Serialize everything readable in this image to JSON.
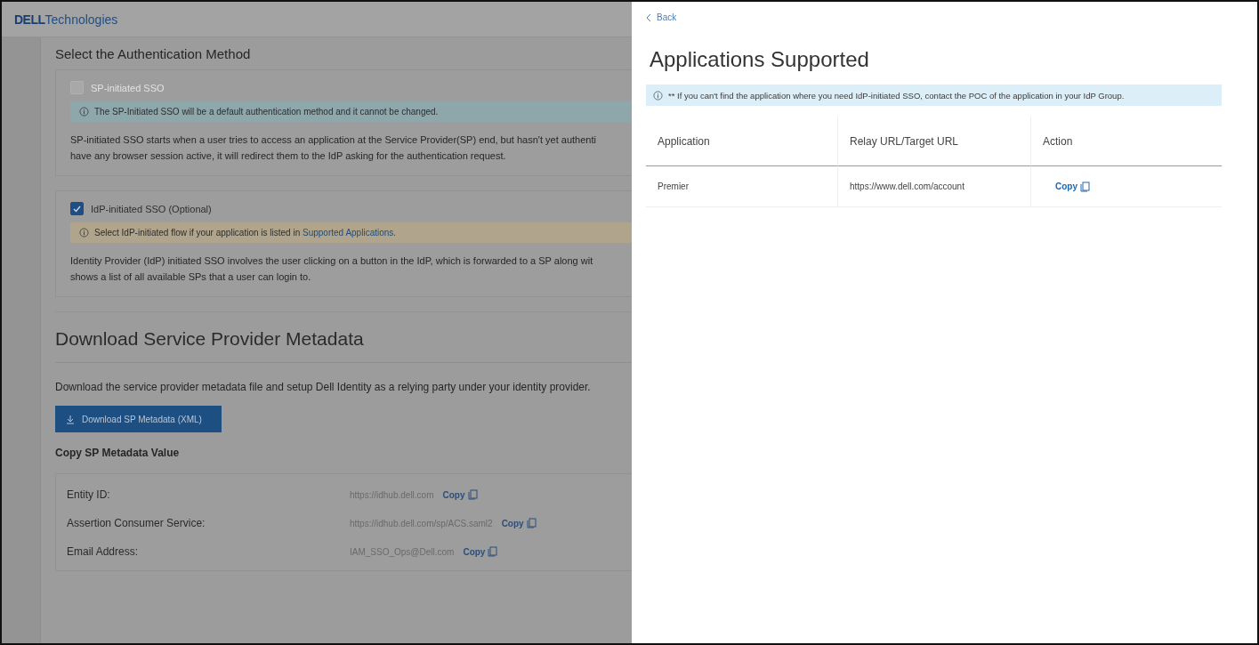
{
  "header": {
    "logo_mark": "DELL",
    "logo_text": "Technologies"
  },
  "authentication": {
    "title": "Select the Authentication Method",
    "options": [
      {
        "label": "SP-initiated SSO",
        "checked": false,
        "disabled": true,
        "notice": {
          "kind": "info",
          "text": "The SP-Initiated SSO will be a default authentication method and it cannot be changed."
        },
        "lines": [
          "SP-initiated SSO starts when a user tries to access an application at the Service Provider(SP) end, but hasn't yet authenti",
          "have any browser session active, it will redirect them to the IdP asking for the authentication request."
        ]
      },
      {
        "label": "IdP-initiated SSO (Optional)",
        "checked": true,
        "disabled": false,
        "notice": {
          "kind": "warning",
          "text": "Select IdP-initiated flow if your application is listed in ",
          "link": "Supported Applications."
        },
        "lines": [
          "Identity Provider (IdP) initiated SSO involves the user clicking on a button in the IdP, which is forwarded to a SP along wit",
          "shows a list of all available SPs that a user can login to."
        ]
      }
    ]
  },
  "download": {
    "title": "Download Service Provider Metadata",
    "description": "Download the service provider metadata file and setup Dell Identity as a relying party under your identity provider.",
    "button": "Download SP Metadata (XML)",
    "copy_title": "Copy SP Metadata Value",
    "rows": [
      {
        "label": "Entity ID:",
        "value": "https://idhub.dell.com",
        "action": "Copy"
      },
      {
        "label": "Assertion Consumer Service:",
        "value": "https://idhub.dell.com/sp/ACS.saml2",
        "action": "Copy"
      },
      {
        "label": "Email Address:",
        "value": "IAM_SSO_Ops@Dell.com",
        "action": "Copy"
      }
    ]
  },
  "panel": {
    "back": "Back",
    "title": "Applications Supported",
    "notice": "** If you can't find the application where you need IdP-initiated SSO, contact the POC of the application in your IdP Group.",
    "columns": [
      "Application",
      "Relay URL/Target URL",
      "Action"
    ],
    "rows": [
      {
        "application": "Premier",
        "url": "https://www.dell.com/account",
        "action": "Copy"
      }
    ]
  }
}
